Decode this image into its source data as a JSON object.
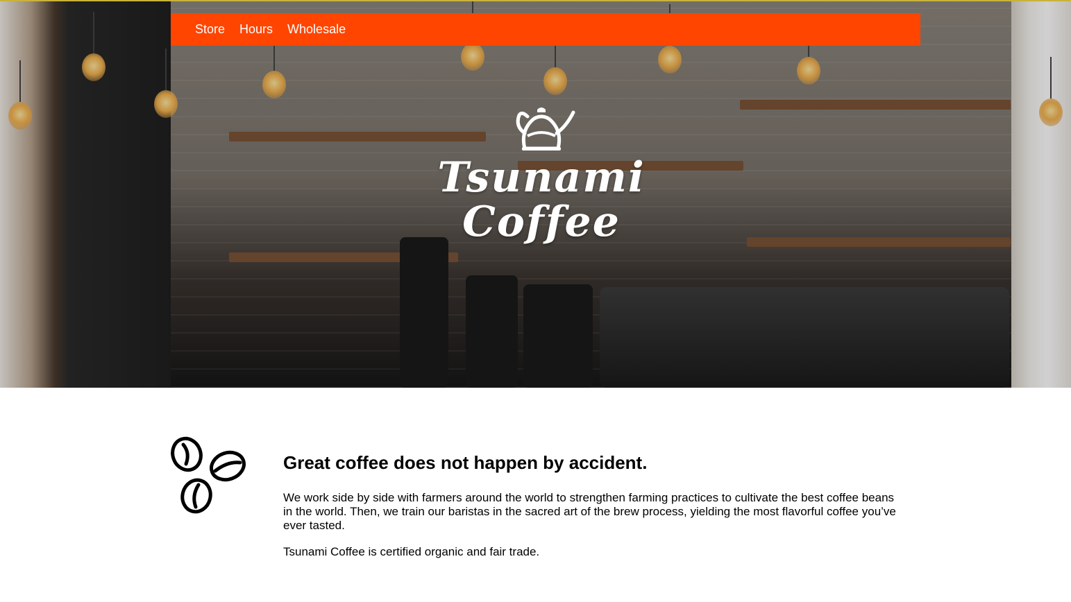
{
  "nav": {
    "items": [
      {
        "label": "Store"
      },
      {
        "label": "Hours"
      },
      {
        "label": "Wholesale"
      }
    ],
    "background_color": "#ff4500"
  },
  "hero": {
    "brand_line1": "Tsunami",
    "brand_line2": "Coffee",
    "logo_icon": "kettle-icon"
  },
  "intro": {
    "icon": "coffee-beans-icon",
    "headline": "Great coffee does not happen by accident.",
    "paragraph1": "We work side by side with farmers around the world to strengthen farming practices to cultivate the best coffee beans in the world. Then, we train our baristas in the sacred art of the brew process, yielding the most flavorful coffee you’ve ever tasted.",
    "paragraph2": "Tsunami Coffee is certified organic and fair trade."
  }
}
